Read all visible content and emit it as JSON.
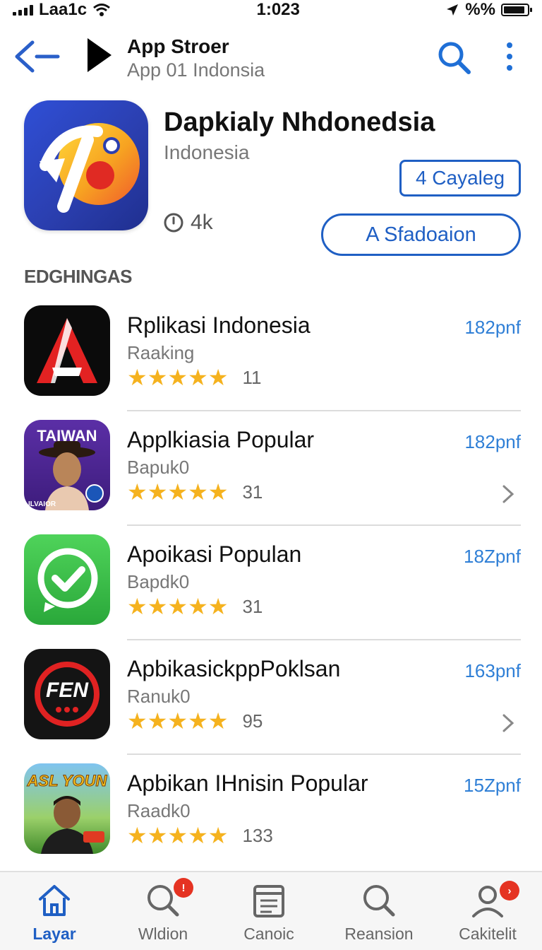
{
  "status_bar": {
    "carrier": "Laa1c",
    "time": "1:023",
    "battery_text": "%%"
  },
  "header": {
    "title": "App Stroer",
    "subtitle": "App 01 Indonsia"
  },
  "featured": {
    "name": "Dapkialy Nhdonedsia",
    "region": "Indonesia",
    "stat": "4k",
    "category_button": "4 Cayaleg",
    "primary_button": "A Sfadoaion"
  },
  "section": {
    "label": "EDGHINGAS"
  },
  "apps": [
    {
      "title": "Rplikasi Indonesia",
      "subtitle": "Raaking",
      "rating": 4.5,
      "count": "11",
      "size": "182pnf",
      "chevron": false,
      "icon": "letter-a-icon"
    },
    {
      "title": "Applkiasia Popular",
      "subtitle": "Bapuk0",
      "rating": 4.7,
      "count": "31",
      "size": "182pnf",
      "chevron": true,
      "icon": "portrait-badge-icon",
      "icon_text": "TAIWAN",
      "icon_caption": "ILVAIOR"
    },
    {
      "title": "Apoikasi Populan",
      "subtitle": "Bapdk0",
      "rating": 4.8,
      "count": "31",
      "size": "18Zpnf",
      "chevron": false,
      "icon": "chat-check-icon"
    },
    {
      "title": "ApbikasickppPoklsan",
      "subtitle": "Ranuk0",
      "rating": 4.8,
      "count": "95",
      "size": "163pnf",
      "chevron": true,
      "icon": "fen-record-icon",
      "icon_text": "FEN"
    },
    {
      "title": "Apbikan IHnisin Popular",
      "subtitle": "Raadk0",
      "rating": 4.6,
      "count": "133",
      "size": "15Zpnf",
      "chevron": false,
      "icon": "portrait-game-icon",
      "icon_text": "ASL YOUN"
    }
  ],
  "bottom_nav": [
    {
      "label": "Layar",
      "active": true,
      "icon": "home-icon",
      "badge": ""
    },
    {
      "label": "Wldion",
      "active": false,
      "icon": "search-icon",
      "badge": "!"
    },
    {
      "label": "Canoic",
      "active": false,
      "icon": "calendar-icon",
      "badge": ""
    },
    {
      "label": "Reansion",
      "active": false,
      "icon": "magnifier-icon",
      "badge": ""
    },
    {
      "label": "Cakitelit",
      "active": false,
      "icon": "profile-icon",
      "badge": "›"
    }
  ],
  "colors": {
    "accent": "#1f5fc4",
    "size_text": "#2f7fd6",
    "star": "#f5b21e",
    "badge": "#e53322"
  }
}
